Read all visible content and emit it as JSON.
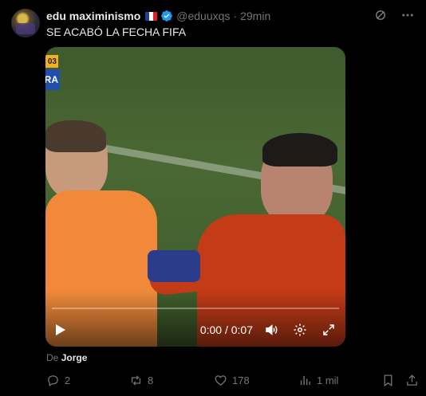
{
  "author": {
    "name": "edu maximinismo",
    "handle": "@eduuxqs",
    "separator": "·",
    "time": "29min"
  },
  "icons": {
    "flag": "france-flag-icon",
    "verified": "verified-badge-icon",
    "grok": "grok-icon",
    "more": "more-options-icon",
    "play": "play-icon",
    "volume": "volume-icon",
    "settings": "gear-icon",
    "fullscreen": "fullscreen-icon",
    "reply": "reply-icon",
    "repost": "repost-icon",
    "like": "heart-icon",
    "views": "views-icon",
    "bookmark": "bookmark-icon",
    "share": "share-icon"
  },
  "tweet": {
    "text": "SE ACABÓ LA FECHA FIFA"
  },
  "video": {
    "score_overlay": "03",
    "team_overlay": "RA",
    "timecode": "0:00 / 0:07",
    "progress": 0
  },
  "attribution": {
    "prefix": "De",
    "source": "Jorge"
  },
  "metrics": {
    "replies": "2",
    "reposts": "8",
    "likes": "178",
    "views": "1 mil"
  },
  "colors": {
    "background": "#000000",
    "text": "#e7e9ea",
    "muted": "#71767b",
    "verified": "#1d9bf0"
  }
}
